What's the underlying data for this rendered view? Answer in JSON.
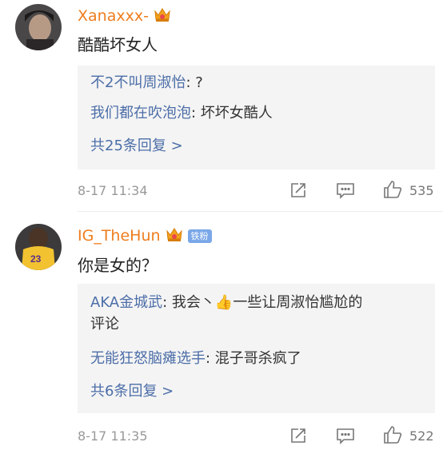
{
  "comments": [
    {
      "username": "Xanaxxx-",
      "text": "酷酷坏女人",
      "replies": [
        {
          "author": "不2不叫周淑怡",
          "text": ": ?"
        },
        {
          "author": "我们都在吹泡泡",
          "text": ": 坏坏女酷人"
        }
      ],
      "more_replies": "共25条回复 >",
      "time": "8-17 11:34",
      "likes": "535"
    },
    {
      "username": "IG_TheHun",
      "badge": "铁粉",
      "text": "你是女的？",
      "replies": [
        {
          "author": "AKA金城武",
          "text": ": 我会丶👍一些让周淑怡尴尬的",
          "text2": "评论"
        },
        {
          "author": "无能狂怒脑瘫选手",
          "text": ": 混子哥杀疯了"
        }
      ],
      "more_replies": "共6条回复 >",
      "time": "8-17 11:35",
      "likes": "522"
    }
  ],
  "colors": {
    "username": "#ee7d1e",
    "reply_author": "#4c6ea8",
    "badge": "#7aa7e8"
  },
  "icons": [
    "crown-badge-icon",
    "share-icon",
    "comment-icon",
    "like-icon",
    "chevron-right-icon"
  ]
}
